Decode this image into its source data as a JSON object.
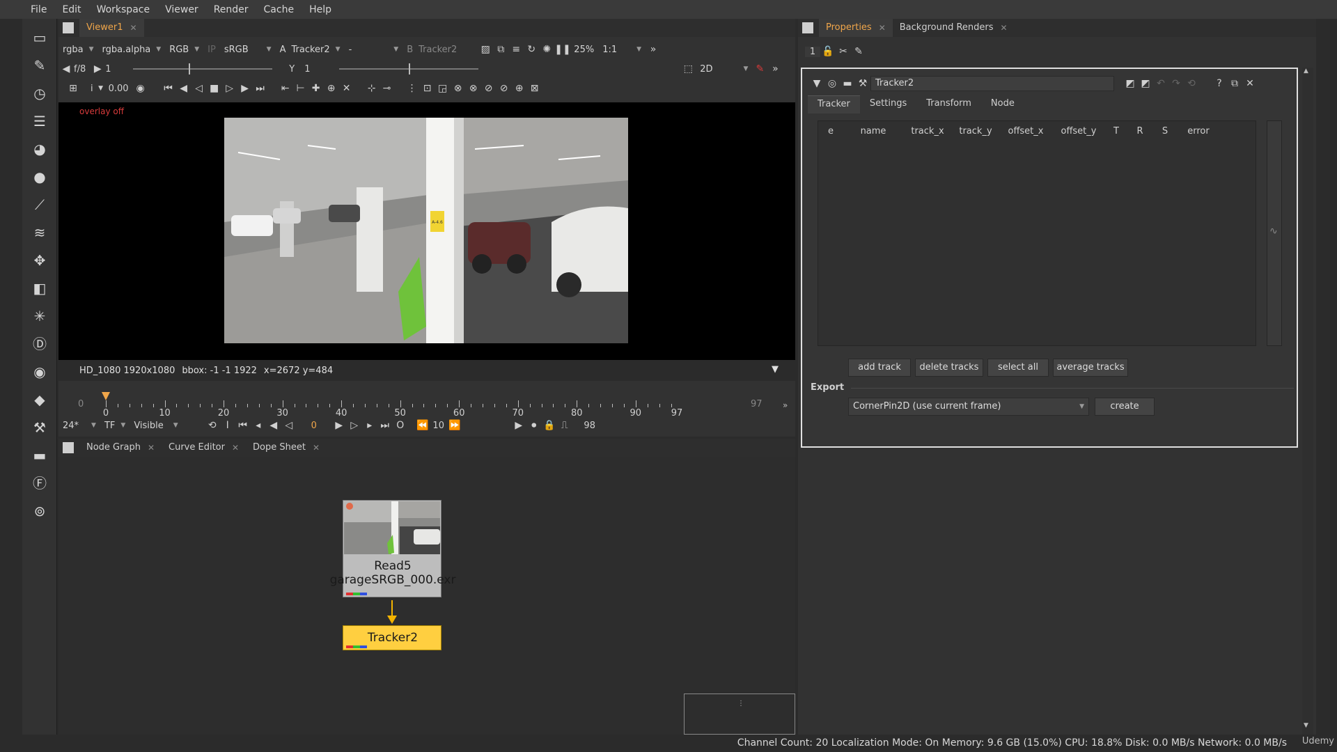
{
  "menu": [
    "File",
    "Edit",
    "Workspace",
    "Viewer",
    "Render",
    "Cache",
    "Help"
  ],
  "toolbar_icons": [
    "image-icon",
    "draw-icon",
    "time-icon",
    "channel-icon",
    "color-icon",
    "filter-icon",
    "keyer-icon",
    "merge-icon",
    "transform-icon",
    "3d-icon",
    "particles-icon",
    "deep-icon",
    "views-icon",
    "metadata-icon",
    "toolsets-icon",
    "other-icon",
    "furnace-icon",
    "ocula-icon"
  ],
  "viewer": {
    "tab": "Viewer1",
    "channels": "rgba",
    "alpha": "rgba.alpha",
    "color": "RGB",
    "ip": "IP",
    "lut": "sRGB",
    "a_label": "A",
    "a_input": "Tracker2",
    "op": "-",
    "b_label": "B",
    "b_input": "Tracker2",
    "zoom": "25%",
    "ratio": "1:1",
    "fstop": "f/8",
    "gain": "1",
    "gamma_label": "Y",
    "gamma": "1",
    "view_mode": "2D",
    "gain_value": "0.00",
    "gain_i": "i",
    "overlay": "overlay off",
    "format": "HD_1080 1920x1080",
    "bbox": "bbox: -1 -1 1922",
    "coords": "x=2672 y=484",
    "sign": "A-4.6"
  },
  "timeline": {
    "start": "0",
    "end": "97",
    "current": "0",
    "labels": [
      "0",
      "10",
      "20",
      "30",
      "40",
      "50",
      "60",
      "70",
      "80",
      "90",
      "97"
    ],
    "fps": "24*",
    "tf": "TF",
    "visible": "Visible",
    "frame": "0",
    "step": "10",
    "last": "98"
  },
  "bottom_tabs": [
    "Node Graph",
    "Curve Editor",
    "Dope Sheet"
  ],
  "nodes": {
    "read_name": "Read5",
    "read_file": "garageSRGB_000.exr",
    "tracker_name": "Tracker2"
  },
  "properties": {
    "tabs": [
      "Properties",
      "Background Renders"
    ],
    "count": "1",
    "node_name": "Tracker2",
    "subtabs": [
      "Tracker",
      "Settings",
      "Transform",
      "Node"
    ],
    "columns": [
      "e",
      "name",
      "track_x",
      "track_y",
      "offset_x",
      "offset_y",
      "T",
      "R",
      "S",
      "error"
    ],
    "buttons": [
      "add track",
      "delete tracks",
      "select all",
      "average tracks"
    ],
    "export_label": "Export",
    "export_option": "CornerPin2D (use current frame)",
    "create": "create"
  },
  "status": "Channel Count: 20 Localization Mode: On Memory: 9.6 GB (15.0%) CPU: 18.8% Disk: 0.0 MB/s Network: 0.0 MB/s",
  "watermark": "Udemy"
}
